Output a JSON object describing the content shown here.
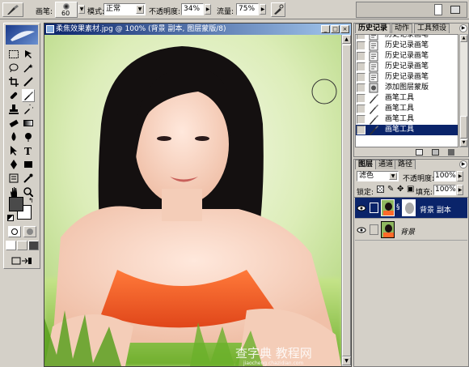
{
  "options_bar": {
    "brush_label": "画笔:",
    "brush_size": "60",
    "mode_label": "模式:",
    "mode_value": "正常",
    "opacity_label": "不透明度:",
    "opacity_value": "34%",
    "flow_label": "流量:",
    "flow_value": "75%"
  },
  "document": {
    "title": "柔焦效果素材.jpg @ 100% (背景 副本, 图层蒙版/8)"
  },
  "history": {
    "tabs": [
      "历史记录",
      "动作",
      "工具预设"
    ],
    "items": [
      {
        "label": "历史记录画笔",
        "icon": "history-brush-icon"
      },
      {
        "label": "历史记录画笔",
        "icon": "history-brush-icon"
      },
      {
        "label": "历史记录画笔",
        "icon": "history-brush-icon"
      },
      {
        "label": "历史记录画笔",
        "icon": "history-brush-icon"
      },
      {
        "label": "历史记录画笔",
        "icon": "history-brush-icon"
      },
      {
        "label": "添加图层蒙版",
        "icon": "layer-mask-icon"
      },
      {
        "label": "画笔工具",
        "icon": "brush-icon"
      },
      {
        "label": "画笔工具",
        "icon": "brush-icon"
      },
      {
        "label": "画笔工具",
        "icon": "brush-icon"
      },
      {
        "label": "画笔工具",
        "icon": "brush-icon"
      }
    ]
  },
  "layers": {
    "tabs": [
      "图层",
      "通道",
      "路径"
    ],
    "blend_mode": "滤色",
    "opacity_label": "不透明度:",
    "opacity_value": "100%",
    "lock_label": "锁定:",
    "fill_label": "填充:",
    "fill_value": "100%",
    "items": [
      {
        "name": "背景 副本"
      },
      {
        "name": "背景"
      }
    ]
  },
  "watermark": {
    "text": "查字典 教程网",
    "url": "jiaocheng.chazidian.com"
  }
}
